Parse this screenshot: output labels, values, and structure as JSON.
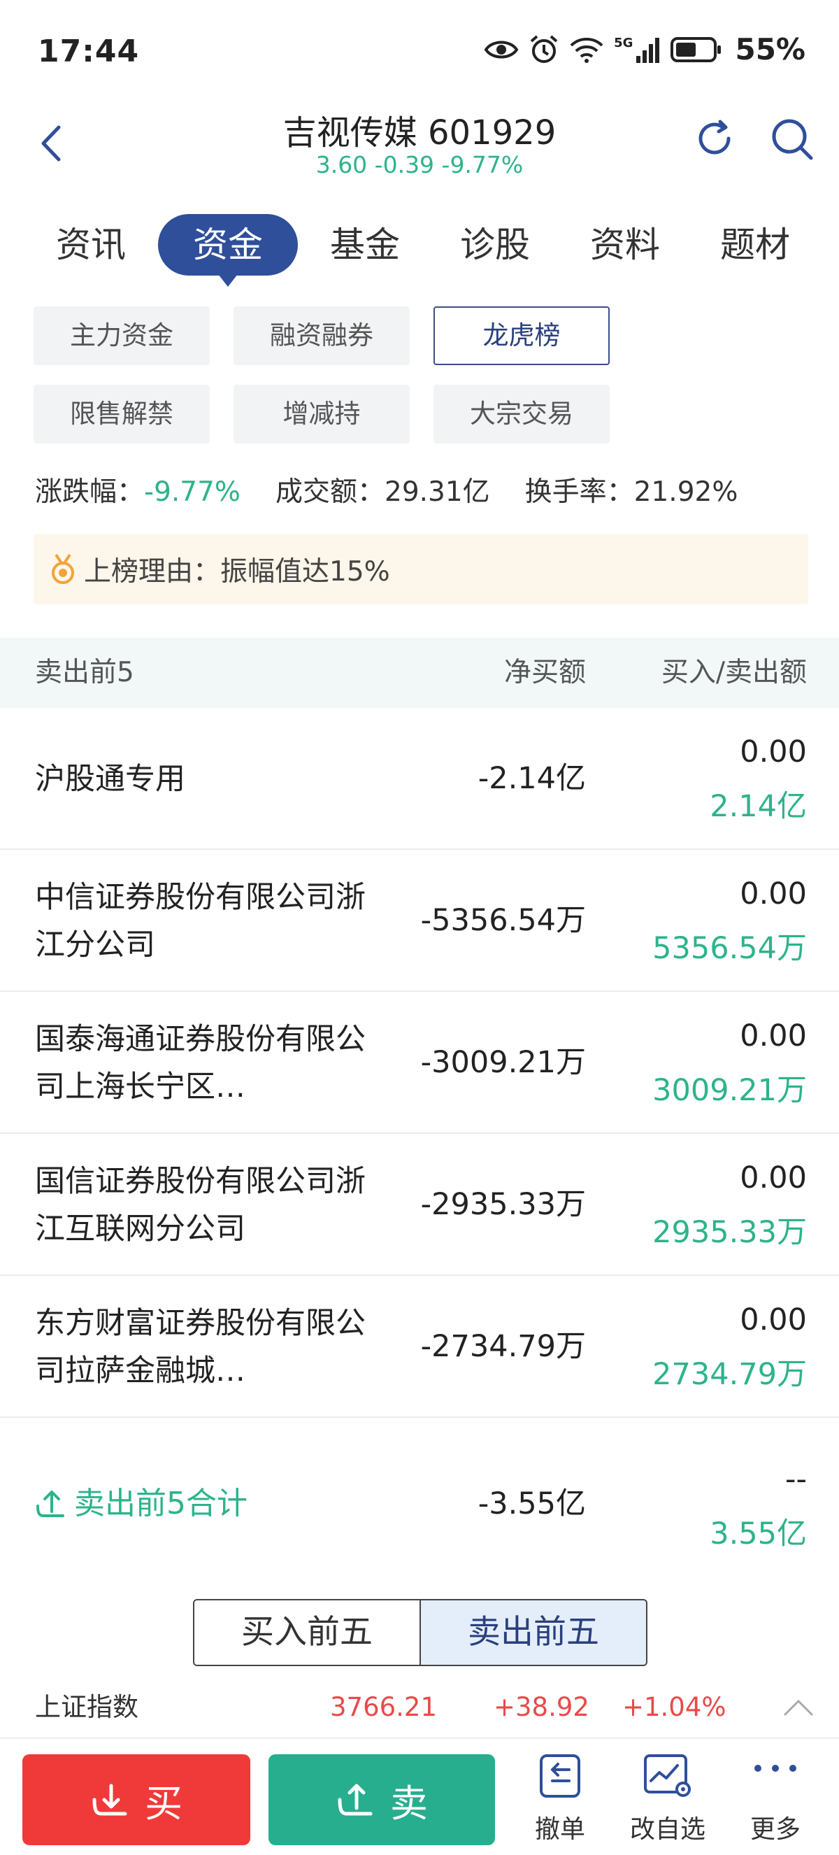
{
  "status_bar": {
    "time": "17:44",
    "network": "5G",
    "battery": "55%"
  },
  "header": {
    "title": "吉视传媒 601929",
    "quote": "3.60  -0.39  -9.77%"
  },
  "main_tabs": [
    "资讯",
    "资金",
    "基金",
    "诊股",
    "资料",
    "题材"
  ],
  "sub_tabs": [
    "主力资金",
    "融资融券",
    "龙虎榜",
    "限售解禁",
    "增减持",
    "大宗交易"
  ],
  "stats": {
    "change_label": "涨跌幅：",
    "change_value": "-9.77%",
    "amount_label": "成交额：",
    "amount_value": "29.31亿",
    "turnover_label": "换手率：",
    "turnover_value": "21.92%"
  },
  "reason": {
    "text": "上榜理由：振幅值达15%"
  },
  "table": {
    "headers": {
      "name": "卖出前5",
      "net": "净买额",
      "buy_sell": "买入/卖出额"
    },
    "rows": [
      {
        "name": "沪股通专用",
        "net": "-2.14亿",
        "buy": "0.00",
        "sell": "2.14亿"
      },
      {
        "name": "中信证券股份有限公司浙江分公司",
        "net": "-5356.54万",
        "buy": "0.00",
        "sell": "5356.54万"
      },
      {
        "name": "国泰海通证券股份有限公司上海长宁区…",
        "net": "-3009.21万",
        "buy": "0.00",
        "sell": "3009.21万"
      },
      {
        "name": "国信证券股份有限公司浙江互联网分公司",
        "net": "-2935.33万",
        "buy": "0.00",
        "sell": "2935.33万"
      },
      {
        "name": "东方财富证券股份有限公司拉萨金融城…",
        "net": "-2734.79万",
        "buy": "0.00",
        "sell": "2734.79万"
      }
    ],
    "total": {
      "label": "卖出前5合计",
      "net": "-3.55亿",
      "buy": "--",
      "sell": "3.55亿"
    }
  },
  "segment": {
    "buy_top5": "买入前五",
    "sell_top5": "卖出前五"
  },
  "index_bar": {
    "name": "上证指数",
    "value": "3766.21",
    "change": "+38.92",
    "pct": "+1.04%"
  },
  "bottom_bar": {
    "buy": "买",
    "sell": "卖",
    "cancel": "撤单",
    "edit_watchlist": "改自选",
    "more": "更多"
  },
  "colors": {
    "up": "#e84a4a",
    "down": "#2db38c",
    "accent": "#2f4f9a",
    "buy_button": "#f03a3a",
    "sell_button": "#27ae8e"
  }
}
